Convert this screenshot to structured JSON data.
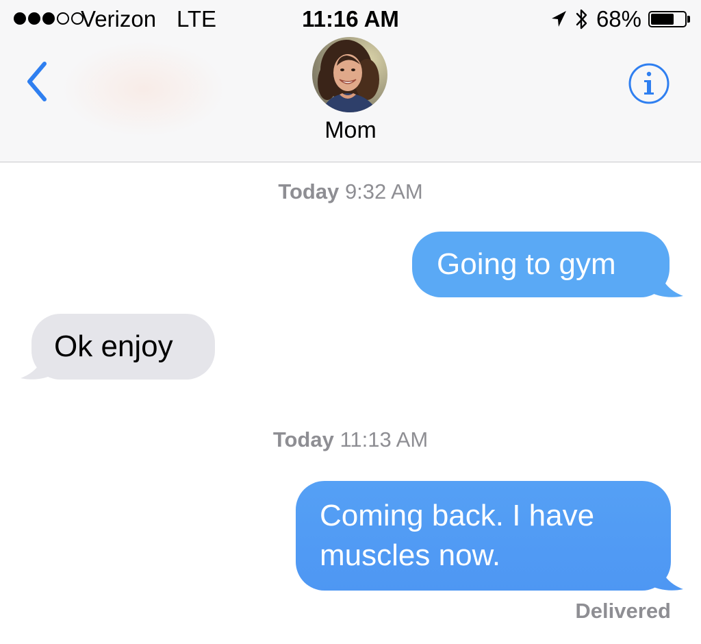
{
  "status_bar": {
    "carrier": "Verizon",
    "network": "LTE",
    "time": "11:16 AM",
    "battery_percent": "68%",
    "battery_level": 0.68,
    "signal_bars_filled": 3,
    "signal_bars_total": 5
  },
  "header": {
    "contact_name": "Mom",
    "back_icon": "chevron-left-icon",
    "info_icon": "info-circle-icon",
    "accent_color": "#2f7ff0"
  },
  "conversation": {
    "groups": [
      {
        "day": "Today",
        "time": "9:32 AM"
      },
      {
        "day": "Today",
        "time": "11:13 AM"
      }
    ],
    "messages": [
      {
        "direction": "sent",
        "text": "Going to gym"
      },
      {
        "direction": "received",
        "text": "Ok enjoy"
      },
      {
        "direction": "sent",
        "lines": [
          "Coming back. I have",
          "muscles now."
        ]
      }
    ],
    "delivery_status": "Delivered"
  },
  "colors": {
    "sent_bubble": "#5aa9f5",
    "received_bubble": "#e5e5ea",
    "timestamp_text": "#8e8e93"
  }
}
